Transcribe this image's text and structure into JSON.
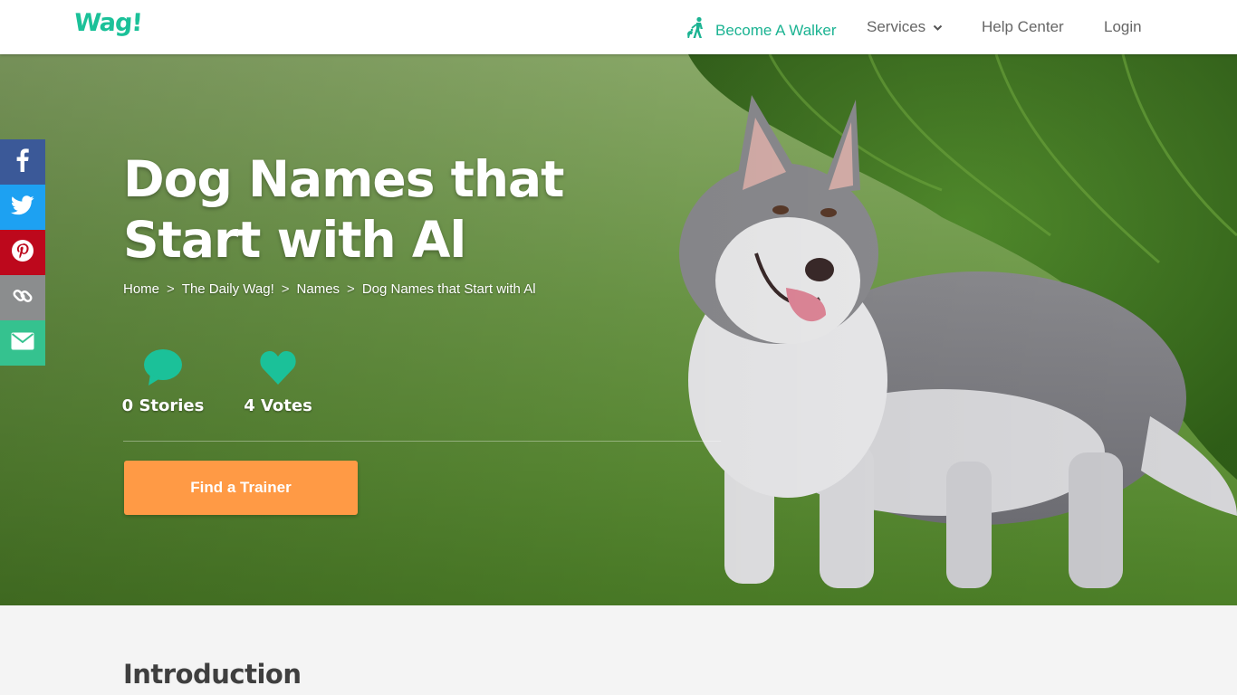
{
  "brand": {
    "logo": "Wag!",
    "accent": "#1bc199"
  },
  "nav": {
    "become_walker": "Become A Walker",
    "services": "Services",
    "help_center": "Help Center",
    "login": "Login"
  },
  "hero": {
    "title": "Dog Names that Start with Al",
    "breadcrumb": [
      "Home",
      "The Daily Wag!",
      "Names",
      "Dog Names that Start with Al"
    ],
    "breadcrumb_sep": ">",
    "stats": {
      "stories": "0 Stories",
      "votes": "4 Votes"
    },
    "cta": "Find a Trainer"
  },
  "social": {
    "icons": [
      "facebook-icon",
      "twitter-icon",
      "pinterest-icon",
      "link-icon",
      "email-icon"
    ],
    "colors": {
      "facebook": "#3b5998",
      "twitter": "#1da1f2",
      "pinterest": "#bd081c",
      "link": "#8b8d8e",
      "email": "#35c28f"
    }
  },
  "content": {
    "section_title": "Introduction"
  },
  "colors": {
    "cta": "#ff9a45",
    "walker": "#1bb392"
  }
}
